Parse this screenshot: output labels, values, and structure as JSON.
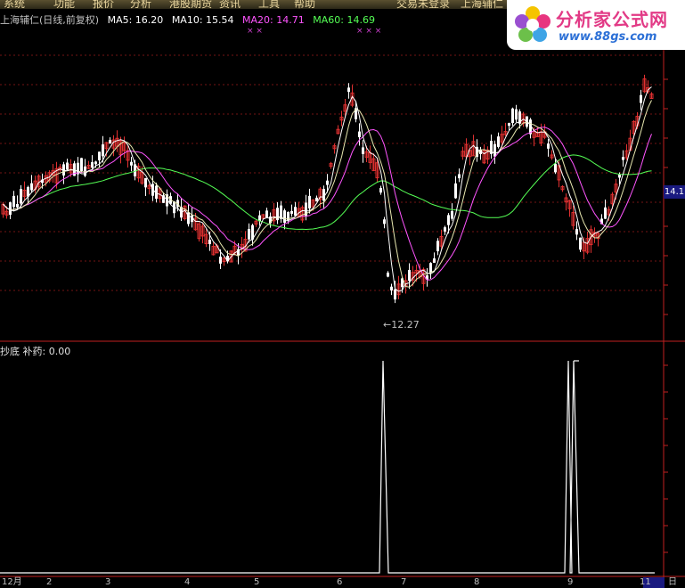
{
  "menu": {
    "items": [
      "系统",
      "功能",
      "报价",
      "分析",
      "港股期货",
      "资讯",
      "工具",
      "帮助",
      "交易未登录",
      "上海辅仁"
    ]
  },
  "logo": {
    "title": "分析家公式网",
    "url": "www.88gs.com"
  },
  "main_chart": {
    "title": "上海辅仁(日线,前复权)",
    "ma": [
      {
        "label": "MA5: 16.20",
        "color": "#ffffff"
      },
      {
        "label": "MA10: 15.54",
        "color": "#ffffff"
      },
      {
        "label": "MA20: 14.71",
        "color": "#ff55ff"
      },
      {
        "label": "MA60: 14.69",
        "color": "#55ff55"
      }
    ],
    "low_label": "12.27",
    "price_tag": "14.1"
  },
  "indicator": {
    "name": "抄底",
    "label": "补药: 0.00"
  },
  "date_axis": {
    "labels": [
      "12月",
      "2",
      "3",
      "4",
      "5",
      "6",
      "7",
      "8",
      "9",
      "11",
      "日"
    ]
  },
  "colors": {
    "up": "#e03030",
    "down": "#ffffff",
    "ma5": "#ffffff",
    "ma10": "#ffffff",
    "ma20": "#ff55ff",
    "ma60": "#55ff55",
    "grid": "#c02020",
    "indicator_line": "#ffffff"
  }
}
